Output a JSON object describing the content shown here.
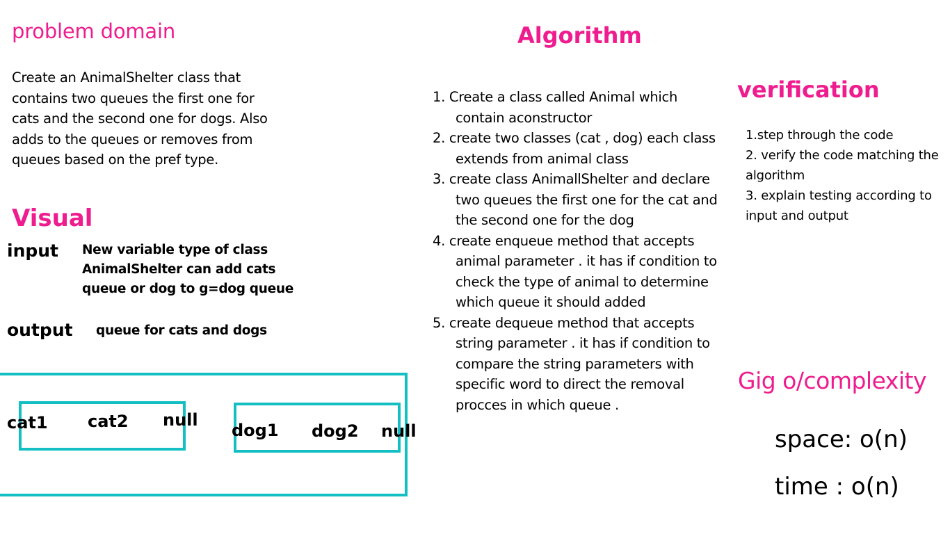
{
  "problem": {
    "title": "problem domain",
    "text": "Create an AnimalShelter class that contains two queues the first one for cats and the second one for dogs. Also adds to the queues or removes from queues based on the pref type."
  },
  "algorithm": {
    "title": "Algorithm",
    "steps": [
      "1. Create a class called Animal which contain aconstructor",
      "2. create two classes (cat , dog) each class extends from animal class",
      "3. create class AnimallShelter and declare two queues the first one for the cat and the second one for the dog",
      "4. create enqueue method that accepts animal parameter . it has if condition to check the type of animal to determine which queue it should added",
      "5.  create dequeue method that accepts string parameter . it has if condition to compare the string parameters with specific word to direct the removal procces in which queue ."
    ]
  },
  "verification": {
    "title": "verification",
    "items": [
      "1.step through the code",
      "2. verify the code matching the algorithm",
      "3. explain  testing according to input and output"
    ]
  },
  "visual": {
    "title": "Visual",
    "input_label": "input",
    "input_text": "New variable type of class AnimalShelter can add cats queue or dog to g=dog queue",
    "output_label": "output",
    "output_text": "queue for cats and dogs",
    "cat_queue": [
      "cat1",
      "cat2",
      "null"
    ],
    "dog_queue": [
      "dog1",
      "dog2",
      "null"
    ]
  },
  "complexity": {
    "title": "Gig o/complexity",
    "space": "space: o(n)",
    "time": "time :  o(n)"
  },
  "colors": {
    "heading": "#ee1c8e",
    "queue_box": "#14bfc4"
  }
}
